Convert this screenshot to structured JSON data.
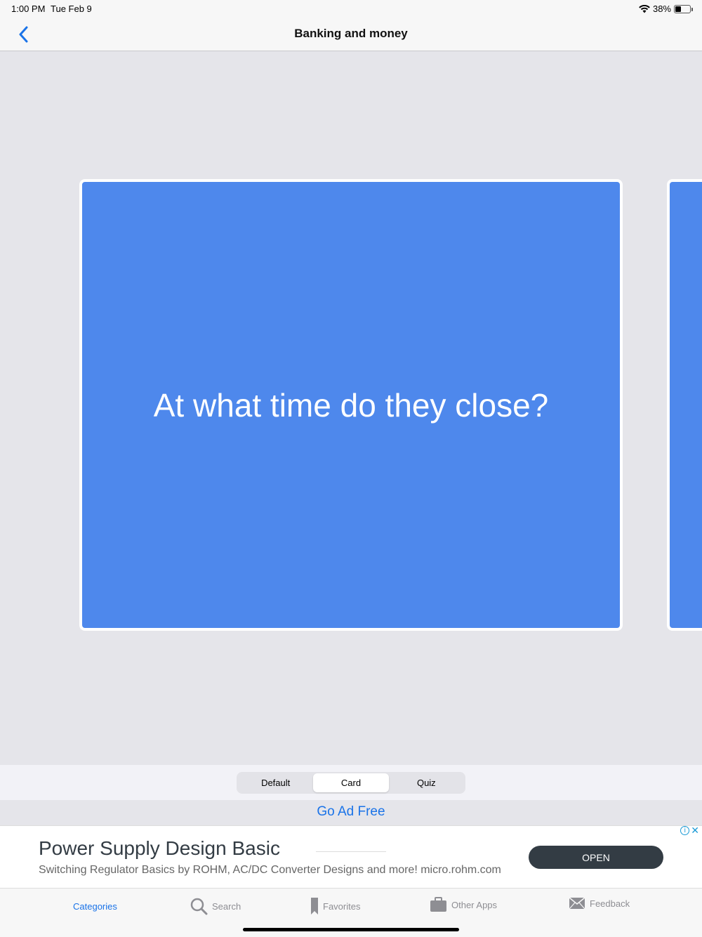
{
  "status": {
    "time": "1:00 PM",
    "date": "Tue Feb 9",
    "battery": "38%",
    "battery_level": 0.38
  },
  "nav": {
    "title": "Banking and money"
  },
  "card": {
    "text": "At what time do they close?"
  },
  "segments": [
    {
      "label": "Default",
      "selected": false
    },
    {
      "label": "Card",
      "selected": true
    },
    {
      "label": "Quiz",
      "selected": false
    }
  ],
  "ad_free": {
    "label": "Go Ad Free"
  },
  "ad": {
    "title": "Power Supply Design Basic",
    "description": "Switching Regulator Basics by ROHM, AC/DC Converter Designs and more! micro.rohm.com",
    "button": "OPEN"
  },
  "tabs": [
    {
      "label": "Categories",
      "icon": "categories-icon",
      "active": true
    },
    {
      "label": "Search",
      "icon": "search-icon",
      "active": false
    },
    {
      "label": "Favorites",
      "icon": "bookmark-icon",
      "active": false
    },
    {
      "label": "Other Apps",
      "icon": "briefcase-icon",
      "active": false
    },
    {
      "label": "Feedback",
      "icon": "envelope-icon",
      "active": false
    }
  ],
  "colors": {
    "accent": "#1a73e8",
    "card": "#4e88ec",
    "ad_button": "#333c44"
  }
}
